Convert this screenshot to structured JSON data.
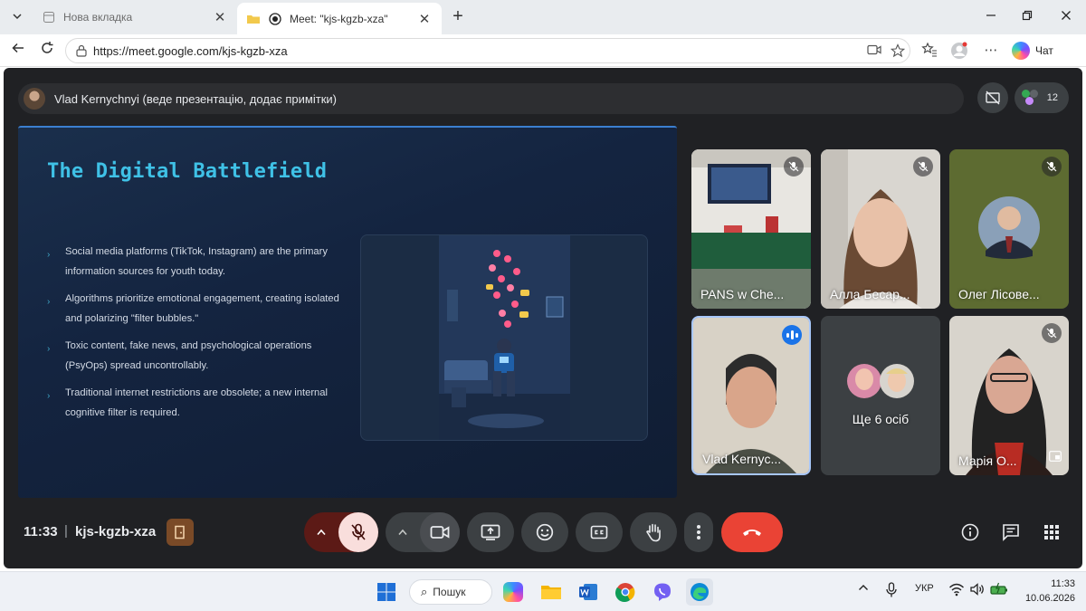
{
  "browser": {
    "tabs": [
      {
        "label": "Нова вкладка",
        "active": false
      },
      {
        "label": "Meet: \"kjs-kgzb-xza\"",
        "active": true
      }
    ],
    "url": "https://meet.google.com/kjs-kgzb-xza",
    "copilot_label": "Чат"
  },
  "meet": {
    "presenter_text": "Vlad Kernychnyi (веде презентацію, додає примітки)",
    "participant_count": "12",
    "slide": {
      "title": "The Digital Battlefield",
      "bullets": [
        "Social media platforms (TikTok, Instagram) are the primary information sources for youth today.",
        "Algorithms prioritize emotional engagement, creating isolated and polarizing \"filter bubbles.\"",
        "Toxic content, fake news, and psychological operations (PsyOps) spread uncontrollably.",
        "Traditional internet restrictions are obsolete; a new internal cognitive filter is required."
      ]
    },
    "tiles": [
      {
        "name": "PANS w Che...",
        "muted": true
      },
      {
        "name": "Алла Бесар...",
        "muted": true
      },
      {
        "name": "Олег Лісове...",
        "muted": true
      },
      {
        "name": "Vlad Kernyc...",
        "speaking": true
      },
      {
        "name": "Ще 6 осіб"
      },
      {
        "name": "Марія О...",
        "muted": true
      }
    ],
    "time": "11:33",
    "separator": "|",
    "meeting_code": "kjs-kgzb-xza"
  },
  "taskbar": {
    "search_label": "Пошук",
    "language": "УКР",
    "time": "11:33",
    "date": "10.06.2026"
  },
  "colors": {
    "meet_bg": "#202124",
    "hangup": "#ea4335",
    "mic_muted_bg": "#f9dedc",
    "accent_title": "#3fc1e6"
  }
}
